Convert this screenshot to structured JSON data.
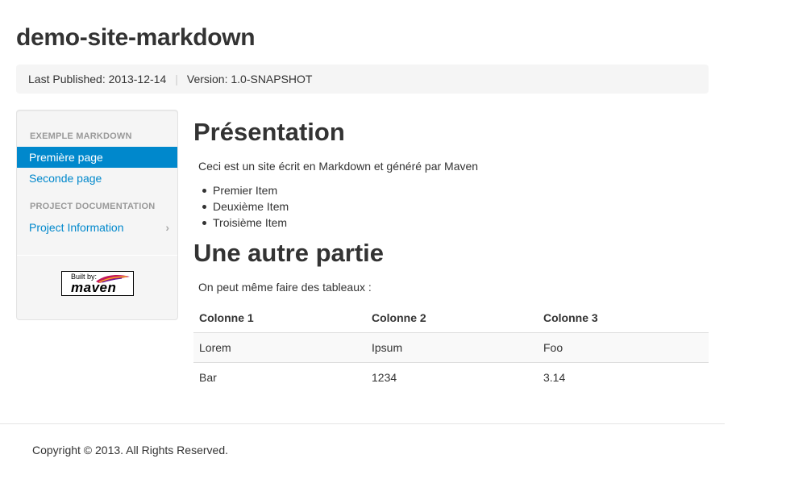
{
  "site": {
    "title": "demo-site-markdown"
  },
  "breadcrumb": {
    "last_published": "Last Published: 2013-12-14",
    "separator": "|",
    "version": "Version: 1.0-SNAPSHOT"
  },
  "sidebar": {
    "sections": [
      {
        "header": "Exemple Markdown",
        "items": [
          {
            "label": "Première page",
            "active": true
          },
          {
            "label": "Seconde page",
            "active": false
          }
        ]
      },
      {
        "header": "Project Documentation",
        "items": [
          {
            "label": "Project Information",
            "active": false,
            "has_chevron": true
          }
        ]
      }
    ],
    "chevron_glyph": "›",
    "badge": {
      "built_by": "Built by:",
      "word": "maven"
    }
  },
  "main": {
    "section1": {
      "heading": "Présentation",
      "intro": "Ceci est un site écrit en Markdown et généré par Maven",
      "bullets": [
        "Premier Item",
        "Deuxième Item",
        "Troisième Item"
      ]
    },
    "section2": {
      "heading": "Une autre partie",
      "intro": "On peut même faire des tableaux :",
      "table": {
        "headers": [
          "Colonne 1",
          "Colonne 2",
          "Colonne 3"
        ],
        "rows": [
          [
            "Lorem",
            "Ipsum",
            "Foo"
          ],
          [
            "Bar",
            "1234",
            "3.14"
          ]
        ]
      }
    }
  },
  "footer": {
    "copyright": "Copyright © 2013. All Rights Reserved."
  },
  "colors": {
    "link": "#0088cc",
    "active_bg": "#0088cc",
    "text": "#333333",
    "muted": "#999999",
    "panel_bg": "#f5f5f5"
  }
}
